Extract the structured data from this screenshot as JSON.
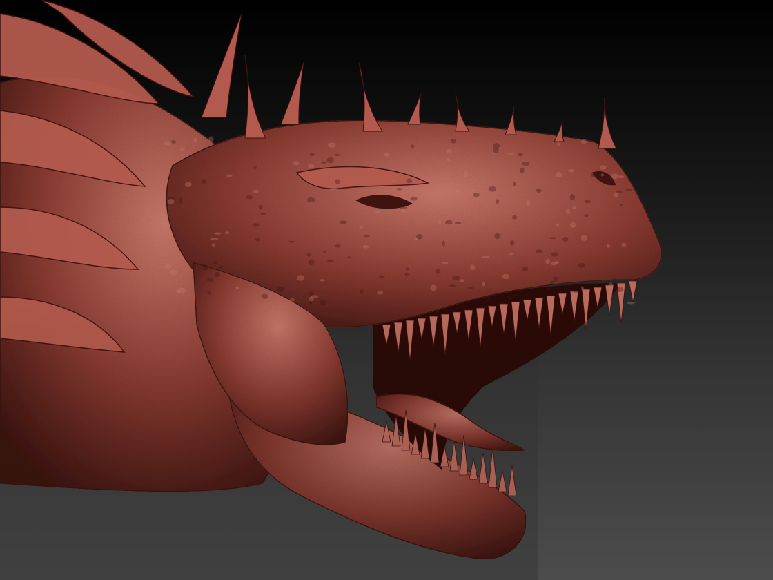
{
  "viewport": {
    "background_top": "#000000",
    "background_bottom": "#4c4c4c"
  },
  "sculpt": {
    "subject": "dragon-head",
    "material_base": "#8a3b31",
    "material_light": "#b25a4d",
    "material_highlight": "#c8786a",
    "material_shadow": "#3f1410",
    "mouth_interior": "#2a0a07",
    "mouth_state": "open",
    "facing": "right",
    "tooth_color": "#b86a5c"
  }
}
